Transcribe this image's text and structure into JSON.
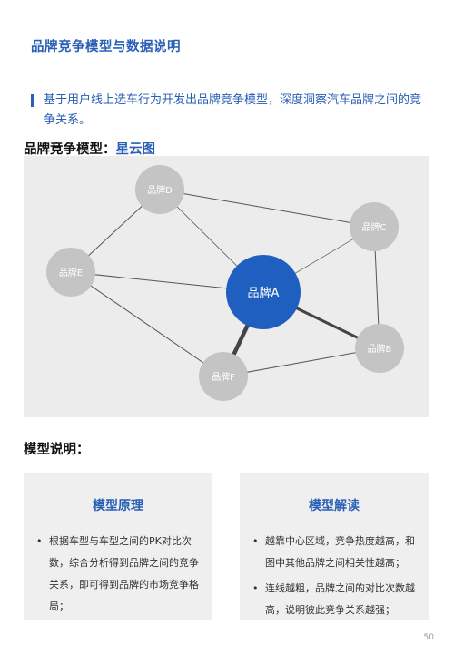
{
  "title": "品牌竞争模型与数据说明",
  "intro": "基于用户线上选车行为开发出品牌竞争模型，深度洞察汽车品牌之间的竞争关系。",
  "chart_heading": {
    "label": "品牌竞争模型：",
    "accent": "星云图"
  },
  "diagram": {
    "nodes": {
      "A": "品牌A",
      "B": "品牌B",
      "C": "品牌C",
      "D": "品牌D",
      "E": "品牌E",
      "F": "品牌F"
    },
    "colors": {
      "center": "#1f5fbf",
      "node": "#c4c4c4",
      "edge": "#555555",
      "background": "#ececec"
    }
  },
  "explain_heading": "模型说明：",
  "cards": [
    {
      "title": "模型原理",
      "bullets": [
        "根据车型与车型之间的PK对比次数，综合分析得到品牌之间的竞争关系，即可得到品牌的市场竞争格局；"
      ]
    },
    {
      "title": "模型解读",
      "bullets": [
        "越靠中心区域，竞争热度越高，和图中其他品牌之间相关性越高；",
        "连线越粗，品牌之间的对比次数越高，说明彼此竞争关系越强；"
      ]
    }
  ],
  "bullet_char": "•",
  "page_number": "50"
}
